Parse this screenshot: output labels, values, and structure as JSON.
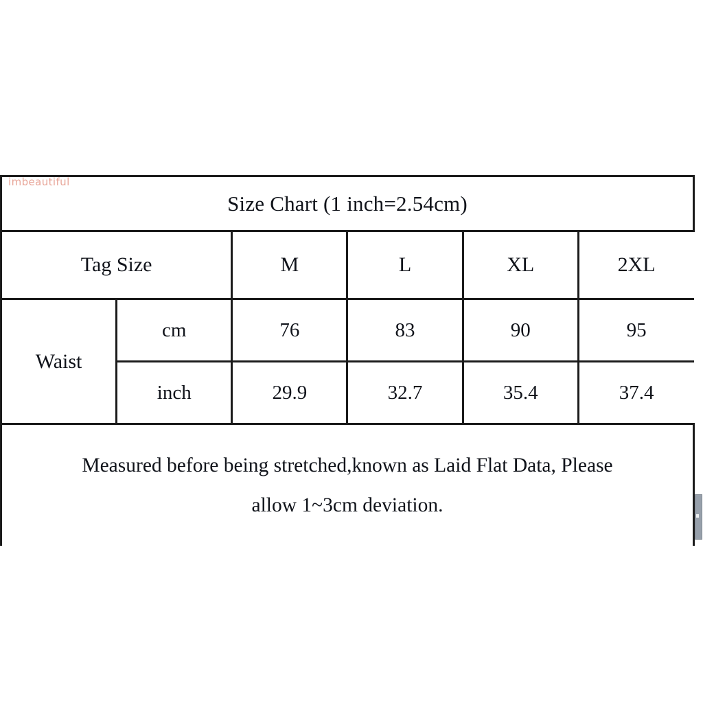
{
  "watermark": {
    "text": "imbeautiful",
    "color": "#e8a598"
  },
  "chart_data": {
    "type": "table",
    "title": "Size Chart (1 inch=2.54cm)",
    "row_header_label": "Tag Size",
    "categories": [
      "M",
      "L",
      "XL",
      "2XL"
    ],
    "measurement_label": "Waist",
    "units": [
      "cm",
      "inch"
    ],
    "series": [
      {
        "name": "cm",
        "values": [
          "76",
          "83",
          "90",
          "95"
        ]
      },
      {
        "name": "inch",
        "values": [
          "29.9",
          "32.7",
          "35.4",
          "37.4"
        ]
      }
    ],
    "note_lines": [
      "Measured before being stretched,known as Laid Flat Data, Please",
      "allow 1~3cm deviation."
    ],
    "border_color": "#1b1b1b",
    "background": "#ffffff"
  },
  "scrollbar": {
    "thumb_color": "#97a0ab"
  }
}
